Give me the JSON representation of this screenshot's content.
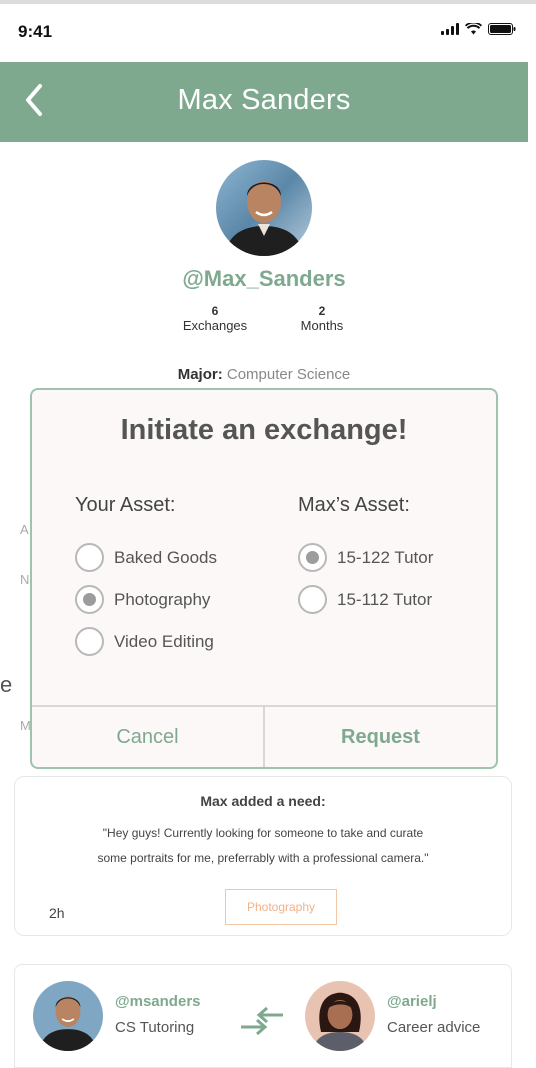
{
  "status_bar": {
    "time": "9:41",
    "icons": [
      "signal-icon",
      "wifi-icon",
      "battery-icon"
    ]
  },
  "header": {
    "title": "Max Sanders",
    "back_icon": "chevron-left-icon",
    "background_color": "#7fa98f"
  },
  "profile": {
    "handle": "@Max_Sanders",
    "exchanges_count": "6",
    "exchanges_label": "Exchanges",
    "months_count": "2",
    "months_label": "Months",
    "major_label": "Major:",
    "major_value": "Computer Science",
    "partial_text": [
      "A",
      "N",
      "e",
      "M"
    ]
  },
  "modal": {
    "title": "Initiate an exchange!",
    "your_asset_title": "Your Asset:",
    "their_asset_title": "Max’s Asset:",
    "your_assets": [
      {
        "label": "Baked Goods",
        "selected": false
      },
      {
        "label": "Photography",
        "selected": true
      },
      {
        "label": "Video Editing",
        "selected": false
      }
    ],
    "their_assets": [
      {
        "label": "15-122 Tutor",
        "selected": true
      },
      {
        "label": "15-112 Tutor",
        "selected": false
      }
    ],
    "cancel_label": "Cancel",
    "request_label": "Request",
    "border_color": "#9fc3ad"
  },
  "need": {
    "title": "Max added a need:",
    "line1": "\"Hey guys! Currently looking for someone to take and curate",
    "line2": "some portraits for me, preferrably with a professional camera.\"",
    "time": "2h",
    "tag": "Photography",
    "tag_color": "#f0b38a"
  },
  "exchange": {
    "left_user": "@msanders",
    "left_skill": "CS Tutoring",
    "right_user": "@arielj",
    "right_skill": "Career advice",
    "icon": "swap-arrows-icon"
  }
}
